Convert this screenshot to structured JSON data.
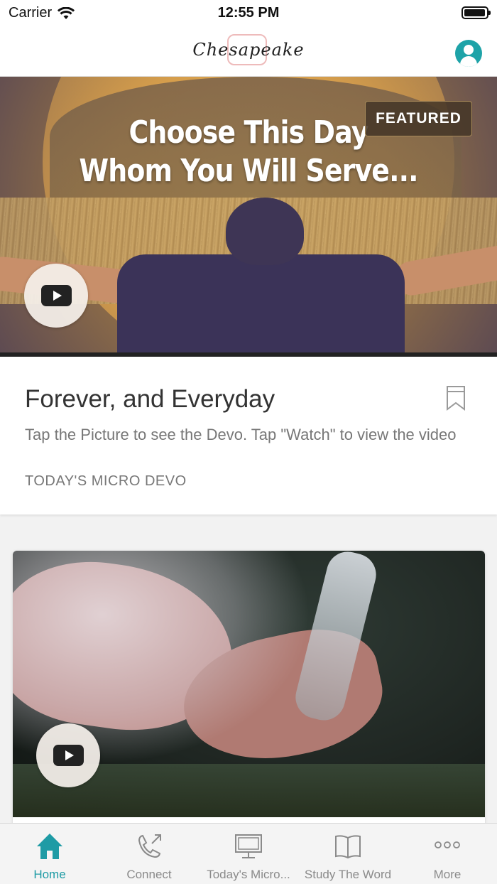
{
  "status_bar": {
    "carrier": "Carrier",
    "time": "12:55 PM"
  },
  "nav": {
    "logo_text": "Chesapeake",
    "profile_icon": "profile-icon"
  },
  "featured": {
    "hero_title_line1": "Choose This Day",
    "hero_title_line2": "Whom You Will Serve...",
    "badge": "FEATURED",
    "title": "Forever, and Everyday",
    "description": "Tap the Picture to see the Devo. Tap \"Watch\" to view the video",
    "category": "TODAY'S MICRO DEVO"
  },
  "tabs": [
    {
      "label": "Home",
      "icon": "home-icon",
      "active": true
    },
    {
      "label": "Connect",
      "icon": "phone-icon",
      "active": false
    },
    {
      "label": "Today's Micro...",
      "icon": "monitor-icon",
      "active": false
    },
    {
      "label": "Study The Word",
      "icon": "book-icon",
      "active": false
    },
    {
      "label": "More",
      "icon": "more-dots-icon",
      "active": false
    }
  ],
  "colors": {
    "accent": "#1e9ba5",
    "tab_inactive": "#8a8a8a"
  }
}
